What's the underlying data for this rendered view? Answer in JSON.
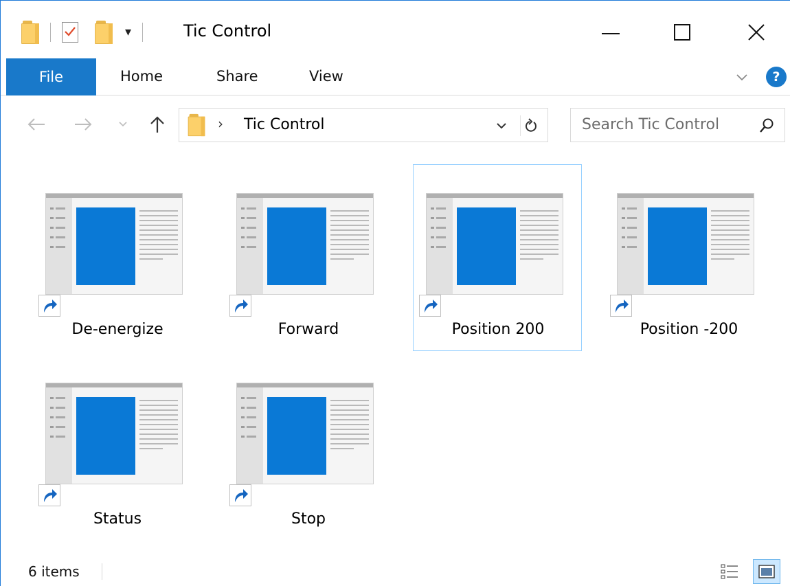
{
  "window": {
    "title": "Tic Control",
    "controls": {
      "minimize": "minimize",
      "maximize": "maximize",
      "close": "close"
    }
  },
  "qat": {
    "dropdown_glyph": "▾"
  },
  "ribbon": {
    "tabs": [
      {
        "label": "File",
        "active": true
      },
      {
        "label": "Home"
      },
      {
        "label": "Share"
      },
      {
        "label": "View"
      }
    ],
    "help_glyph": "?"
  },
  "navigation": {
    "breadcrumb_separator": "›",
    "breadcrumb": [
      "Tic Control"
    ],
    "search_placeholder": "Search Tic Control"
  },
  "items": [
    {
      "label": "De-energize",
      "type": "shortcut",
      "selected": false
    },
    {
      "label": "Forward",
      "type": "shortcut",
      "selected": false
    },
    {
      "label": "Position 200",
      "type": "shortcut",
      "selected": true
    },
    {
      "label": "Position -200",
      "type": "shortcut",
      "selected": false
    },
    {
      "label": "Status",
      "type": "shortcut",
      "selected": false
    },
    {
      "label": "Stop",
      "type": "shortcut",
      "selected": false
    }
  ],
  "statusbar": {
    "item_count": "6 items",
    "active_view": "large-icons"
  },
  "colors": {
    "accent": "#1979ca",
    "selection_border": "#99d1ff",
    "thumb_doc": "#0a79d6",
    "folder": "#fcd06a"
  },
  "icons": [
    "folder-icon",
    "properties-icon",
    "back-arrow-icon",
    "forward-arrow-icon",
    "up-arrow-icon",
    "refresh-icon",
    "search-icon",
    "shortcut-arrow-icon",
    "details-view-icon",
    "large-icons-view-icon",
    "help-icon"
  ]
}
